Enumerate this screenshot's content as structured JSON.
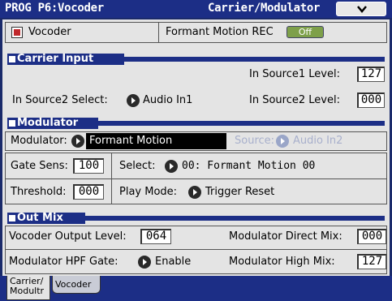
{
  "title": {
    "program": "PROG P6:Vocoder",
    "page": "Carrier/Modulator"
  },
  "menu": {
    "icon": "chevron-down-icon"
  },
  "top_row": {
    "vocoder_label": "Vocoder",
    "formant_motion_rec_label": "Formant Motion REC",
    "formant_motion_rec_value": "Off"
  },
  "carrier_input": {
    "heading": "Carrier Input",
    "in_source1_level_label": "In Source1 Level:",
    "in_source1_level_value": "127",
    "in_source2_select_label": "In Source2 Select:",
    "in_source2_select_value": "Audio In1",
    "in_source2_level_label": "In Source2 Level:",
    "in_source2_level_value": "000"
  },
  "modulator": {
    "heading": "Modulator",
    "modulator_label": "Modulator:",
    "modulator_value": "Formant Motion",
    "source_label": "Source:",
    "source_value": "Audio In2",
    "gate_sens_label": "Gate Sens:",
    "gate_sens_value": "100",
    "select_label": "Select:",
    "select_value": "00: Formant Motion 00",
    "threshold_label": "Threshold:",
    "threshold_value": "000",
    "play_mode_label": "Play Mode:",
    "play_mode_value": "Trigger Reset"
  },
  "out_mix": {
    "heading": "Out Mix",
    "vocoder_output_level_label": "Vocoder Output Level:",
    "vocoder_output_level_value": "064",
    "modulator_direct_mix_label": "Modulator Direct Mix:",
    "modulator_direct_mix_value": "000",
    "modulator_hpf_gate_label": "Modulator HPF Gate:",
    "modulator_hpf_gate_value": "Enable",
    "modulator_high_mix_label": "Modulator High Mix:",
    "modulator_high_mix_value": "127"
  },
  "tabs": [
    {
      "line1": "Carrier/",
      "line2": "Modultr"
    },
    {
      "line1": "Vocoder",
      "line2": ""
    }
  ],
  "colors": {
    "header_blue": "#1c2e86",
    "toggle_green": "#7ea04a",
    "checkbox_red": "#c0282c"
  }
}
